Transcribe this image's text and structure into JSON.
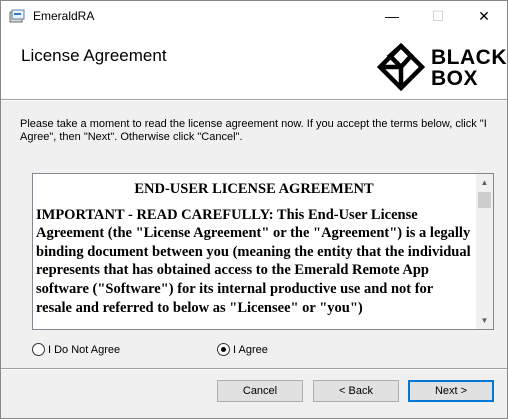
{
  "window": {
    "title": "EmeraldRA",
    "controls": {
      "minimize": "—",
      "maximize": "☐",
      "close": "✕"
    }
  },
  "banner": {
    "title": "License Agreement",
    "logo_text": "BLACK BOX"
  },
  "intro": "Please take a moment to read the license agreement now. If you accept the terms below, click \"I Agree\", then \"Next\". Otherwise click \"Cancel\".",
  "license": {
    "heading": "END-USER LICENSE AGREEMENT",
    "body": "IMPORTANT - READ CAREFULLY:  This End-User License Agreement (the \"License Agreement\" or the \"Agreement\") is a legally binding document between you (meaning the entity that the individual represents that has obtained access to the Emerald Remote App software (\"Software\") for its internal productive use and not for resale and referred to below as \"Licensee\" or \"you\")"
  },
  "options": {
    "disagree_label": "I Do Not Agree",
    "agree_label": "I Agree",
    "selected": "agree"
  },
  "buttons": {
    "cancel": "Cancel",
    "back": "< Back",
    "next": "Next >"
  },
  "colors": {
    "dialog_bg": "#f0f0f0",
    "focus_border": "#0078d7"
  }
}
